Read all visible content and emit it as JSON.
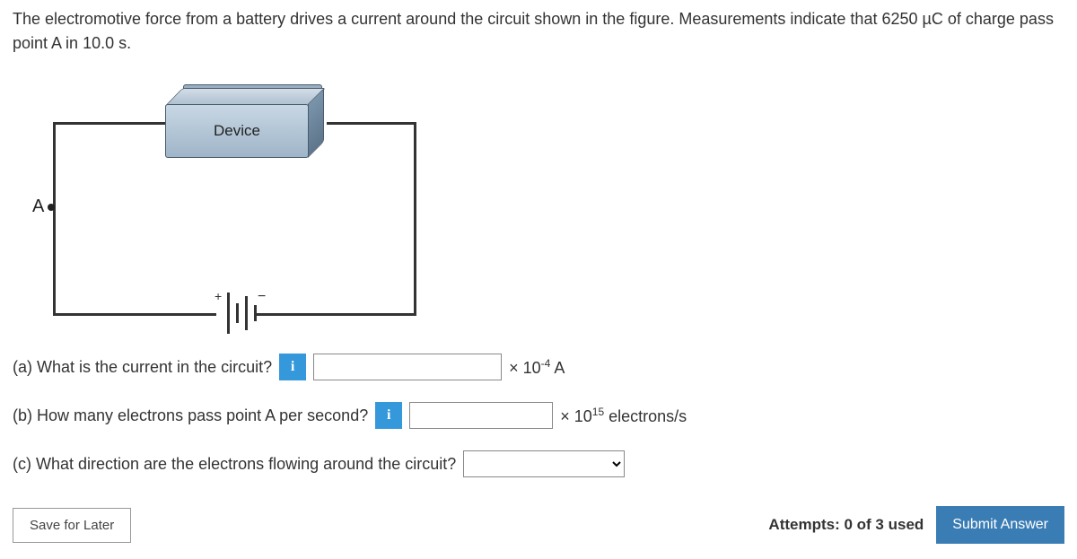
{
  "problem_text": "The electromotive force from a battery drives a current around the circuit shown in the figure. Measurements indicate that 6250 µC of charge pass point A in 10.0 s.",
  "figure": {
    "device_label": "Device",
    "point_label": "A",
    "battery_plus": "+",
    "battery_minus": "−"
  },
  "parts": {
    "a": {
      "prompt": "(a) What is the current in the circuit?",
      "unit_prefix": "× 10",
      "unit_exp": "-4",
      "unit_suffix": " A"
    },
    "b": {
      "prompt": "(b) How many electrons pass point A per second?",
      "unit_prefix": "× 10",
      "unit_exp": "15",
      "unit_suffix": " electrons/s"
    },
    "c": {
      "prompt": "(c) What direction are the electrons flowing around the circuit?"
    }
  },
  "info_icon": "i",
  "footer": {
    "save_label": "Save for Later",
    "attempts_label": "Attempts: 0 of 3 used",
    "submit_label": "Submit Answer"
  }
}
